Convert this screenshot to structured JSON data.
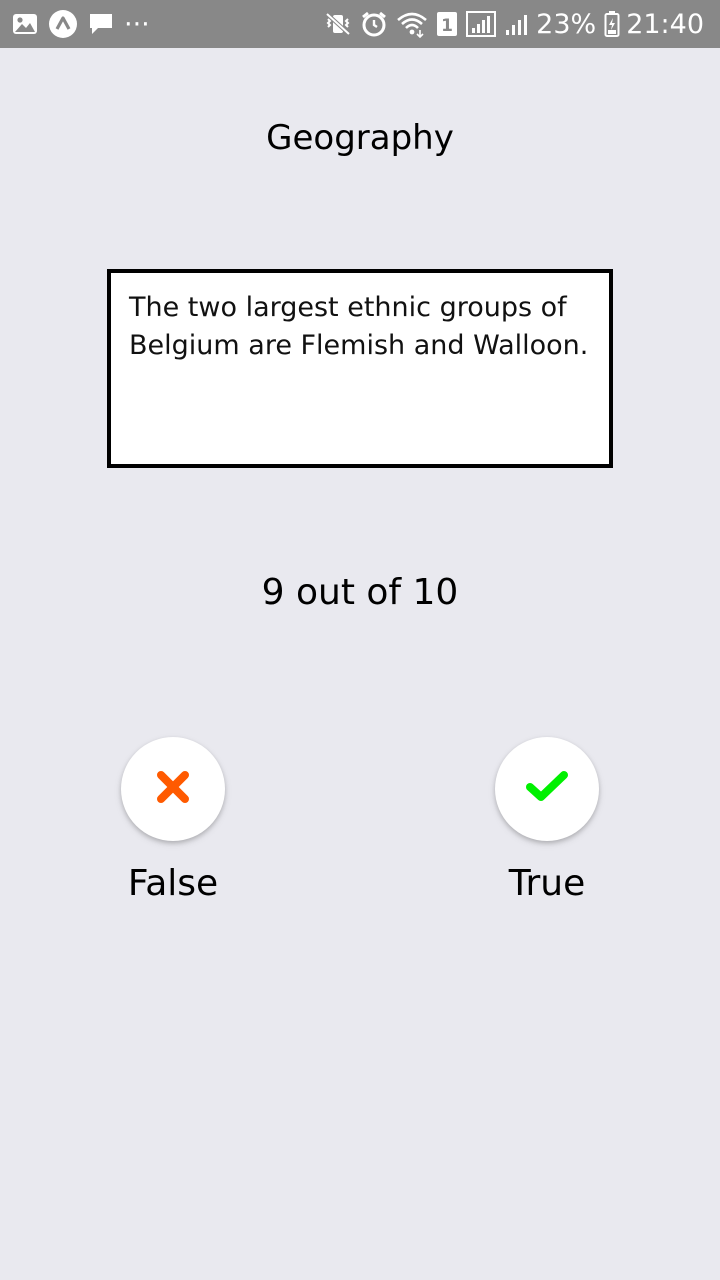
{
  "status_bar": {
    "battery_percent": "23%",
    "time": "21:40",
    "sim_slot": "1",
    "more_indicator": "···",
    "icons": [
      "gallery-icon",
      "app-notification-icon",
      "message-icon",
      "more-dots-icon",
      "mute-vibrate-icon",
      "alarm-icon",
      "wifi-icon",
      "sim-1-icon",
      "signal-icon",
      "signal-2-icon",
      "battery-icon"
    ]
  },
  "quiz": {
    "category": "Geography",
    "question": "The two largest ethnic groups of Belgium are Flemish and Walloon.",
    "progress": "9 out of 10"
  },
  "answers": {
    "false_label": "False",
    "true_label": "True",
    "false_icon": "cross-icon",
    "true_icon": "check-icon",
    "false_color": "#ff5a00",
    "true_color": "#00f000"
  },
  "colors": {
    "background": "#e9e9ef",
    "status_bar": "#888888"
  }
}
